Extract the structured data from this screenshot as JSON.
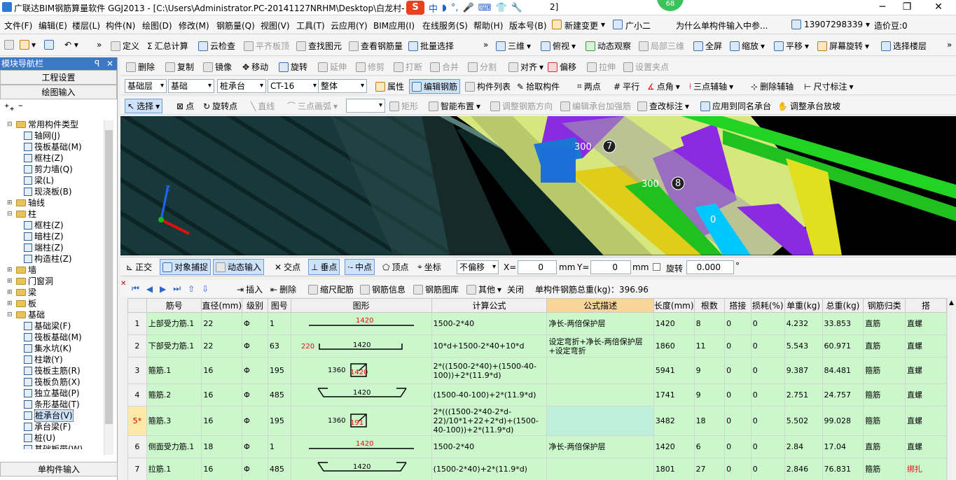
{
  "window": {
    "title": "广联达BIM钢筋算量软件 GGJ2013 - [C:\\Users\\Administrator.PC-20141127NRHM\\Desktop\\白龙村-",
    "title_suffix": "2]",
    "badge": "68",
    "ime": [
      "中",
      "◗",
      "°,",
      "🎤",
      "⌨",
      "👕",
      "🔧"
    ]
  },
  "menu": [
    "文件(F)",
    "编辑(E)",
    "楼层(L)",
    "构件(N)",
    "绘图(D)",
    "修改(M)",
    "钢筋量(Q)",
    "视图(V)",
    "工具(T)",
    "云应用(Y)",
    "BIM应用(I)",
    "在线服务(S)",
    "帮助(H)",
    "版本号(B)",
    "新建变更",
    "广小二",
    "为什么单构件输入中参...",
    "13907298339",
    "造价豆:0"
  ],
  "toolbar1": [
    "定义",
    "汇总计算",
    "云检查",
    "平齐板顶",
    "查找图元",
    "查看钢筋量",
    "批量选择",
    "三维",
    "俯视",
    "动态观察",
    "局部三维",
    "全屏",
    "缩放",
    "平移",
    "屏幕旋转",
    "选择楼层"
  ],
  "left_panel": {
    "title": "模块导航栏",
    "btn_project": "工程设置",
    "btn_draw": "绘图输入",
    "btn_single": "单构件输入",
    "tree": [
      {
        "label": "常用构件类型",
        "level": 1,
        "type": "folder",
        "open": true
      },
      {
        "label": "轴网(J)",
        "level": 2,
        "type": "item"
      },
      {
        "label": "筏板基础(M)",
        "level": 2,
        "type": "item"
      },
      {
        "label": "框柱(Z)",
        "level": 2,
        "type": "item"
      },
      {
        "label": "剪力墙(Q)",
        "level": 2,
        "type": "item"
      },
      {
        "label": "梁(L)",
        "level": 2,
        "type": "item"
      },
      {
        "label": "现浇板(B)",
        "level": 2,
        "type": "item"
      },
      {
        "label": "轴线",
        "level": 1,
        "type": "folder",
        "open": false
      },
      {
        "label": "柱",
        "level": 1,
        "type": "folder",
        "open": true
      },
      {
        "label": "框柱(Z)",
        "level": 2,
        "type": "item"
      },
      {
        "label": "暗柱(Z)",
        "level": 2,
        "type": "item"
      },
      {
        "label": "端柱(Z)",
        "level": 2,
        "type": "item"
      },
      {
        "label": "构造柱(Z)",
        "level": 2,
        "type": "item"
      },
      {
        "label": "墙",
        "level": 1,
        "type": "folder",
        "open": false
      },
      {
        "label": "门窗洞",
        "level": 1,
        "type": "folder",
        "open": false
      },
      {
        "label": "梁",
        "level": 1,
        "type": "folder",
        "open": false
      },
      {
        "label": "板",
        "level": 1,
        "type": "folder",
        "open": false
      },
      {
        "label": "基础",
        "level": 1,
        "type": "folder",
        "open": true
      },
      {
        "label": "基础梁(F)",
        "level": 2,
        "type": "item"
      },
      {
        "label": "筏板基础(M)",
        "level": 2,
        "type": "item"
      },
      {
        "label": "集水坑(K)",
        "level": 2,
        "type": "item"
      },
      {
        "label": "柱墩(Y)",
        "level": 2,
        "type": "item"
      },
      {
        "label": "筏板主筋(R)",
        "level": 2,
        "type": "item"
      },
      {
        "label": "筏板负筋(X)",
        "level": 2,
        "type": "item"
      },
      {
        "label": "独立基础(P)",
        "level": 2,
        "type": "item"
      },
      {
        "label": "条形基础(T)",
        "level": 2,
        "type": "item"
      },
      {
        "label": "桩承台(V)",
        "level": 2,
        "type": "item",
        "selected": true
      },
      {
        "label": "承台梁(F)",
        "level": 2,
        "type": "item"
      },
      {
        "label": "桩(U)",
        "level": 2,
        "type": "item"
      },
      {
        "label": "基础板带(W)",
        "level": 2,
        "type": "item"
      }
    ]
  },
  "toolbar2": [
    "删除",
    "复制",
    "镜像",
    "移动",
    "旋转",
    "延伸",
    "修剪",
    "打断",
    "合并",
    "分割",
    "对齐",
    "偏移",
    "拉伸",
    "设置夹点"
  ],
  "toolbar3": {
    "selects": [
      "基础层",
      "基础",
      "桩承台",
      "CT-16",
      "整体"
    ],
    "buttons": [
      "属性",
      "编辑钢筋",
      "构件列表",
      "拾取构件",
      "两点",
      "平行",
      "点角",
      "三点辅轴",
      "删除辅轴",
      "尺寸标注"
    ]
  },
  "toolbar4": [
    "选择",
    "点",
    "旋转点",
    "直线",
    "三点画弧",
    "矩形",
    "智能布置",
    "调整钢筋方向",
    "编辑承台加强筋",
    "查改标注",
    "应用到同名承台",
    "调整承台放坡"
  ],
  "viewport": {
    "labels": [
      "300",
      "7",
      "300",
      "8",
      "0"
    ]
  },
  "snapbar": {
    "items": [
      "正交",
      "对象捕捉",
      "动态输入",
      "交点",
      "垂点",
      "中点",
      "顶点",
      "坐标"
    ],
    "offset": "不偏移",
    "x_label": "X=",
    "x_value": "0",
    "y_label": "Y=",
    "y_value": "0",
    "unit": "mm",
    "rotate": "旋转",
    "rotate_value": "0.000",
    "deg": "°"
  },
  "gridbar": {
    "items": [
      "插入",
      "删除",
      "缩尺配筋",
      "钢筋信息",
      "钢筋图库",
      "其他",
      "关闭"
    ],
    "total": "单构件钢筋总重(kg)：396.96"
  },
  "grid": {
    "columns": [
      "",
      "筋号",
      "直径(mm)",
      "级别",
      "图号",
      "图形",
      "计算公式",
      "公式描述",
      "长度(mm)",
      "根数",
      "搭接",
      "损耗(%)",
      "单重(kg)",
      "总重(kg)",
      "钢筋归类",
      "搭"
    ],
    "rows": [
      {
        "n": "1",
        "name": "上部受力筋.1",
        "d": "22",
        "grade": "Φ",
        "fig": "1",
        "shape": "line",
        "s1": "1420",
        "s2": "",
        "s3": "",
        "formula": "1500-2*40",
        "desc": "净长-两倍保护层",
        "len": "1420",
        "cnt": "8",
        "lap": "0",
        "loss": "0",
        "unit": "4.232",
        "total": "33.853",
        "cls": "直筋",
        "conn": "直螺"
      },
      {
        "n": "2",
        "name": "下部受力筋.1",
        "d": "22",
        "grade": "Φ",
        "fig": "63",
        "shape": "bracket",
        "s1": "1420",
        "s2": "220",
        "s3": "",
        "formula": "10*d+1500-2*40+10*d",
        "desc": "设定弯折+净长-两倍保护层+设定弯折",
        "len": "1860",
        "cnt": "11",
        "lap": "0",
        "loss": "0",
        "unit": "5.543",
        "total": "60.971",
        "cls": "直筋",
        "conn": "直螺"
      },
      {
        "n": "3",
        "name": "箍筋.1",
        "d": "16",
        "grade": "Φ",
        "fig": "195",
        "shape": "stirrup",
        "s1": "1420",
        "s2": "1360",
        "s3": "",
        "formula": "2*((1500-2*40)+(1500-40-100))+2*(11.9*d)",
        "desc": "",
        "len": "5941",
        "cnt": "9",
        "lap": "0",
        "loss": "0",
        "unit": "9.387",
        "total": "84.481",
        "cls": "箍筋",
        "conn": "直螺"
      },
      {
        "n": "4",
        "name": "箍筋.2",
        "d": "16",
        "grade": "Φ",
        "fig": "485",
        "shape": "tie",
        "s1": "1420",
        "s2": "",
        "s3": "",
        "formula": "(1500-40-100)+2*(11.9*d)",
        "desc": "",
        "len": "1741",
        "cnt": "9",
        "lap": "0",
        "loss": "0",
        "unit": "2.751",
        "total": "24.757",
        "cls": "箍筋",
        "conn": "直螺"
      },
      {
        "n": "5*",
        "name": "箍筋.3",
        "d": "16",
        "grade": "Φ",
        "fig": "195",
        "shape": "stirrup",
        "s1": "191",
        "s2": "1360",
        "s3": "",
        "formula": "2*(((1500-2*40-2*d-22)/10*1+22+2*d)+(1500-40-100))+2*(11.9*d)",
        "desc": "",
        "len": "3482",
        "cnt": "18",
        "lap": "0",
        "loss": "0",
        "unit": "5.502",
        "total": "99.028",
        "cls": "箍筋",
        "conn": "直螺",
        "current": true
      },
      {
        "n": "6",
        "name": "侧面受力筋.1",
        "d": "18",
        "grade": "Φ",
        "fig": "1",
        "shape": "line",
        "s1": "1420",
        "s2": "",
        "s3": "",
        "formula": "1500-2*40",
        "desc": "净长-两倍保护层",
        "len": "1420",
        "cnt": "6",
        "lap": "0",
        "loss": "0",
        "unit": "2.84",
        "total": "17.04",
        "cls": "直筋",
        "conn": "直螺"
      },
      {
        "n": "7",
        "name": "拉筋.1",
        "d": "16",
        "grade": "Φ",
        "fig": "485",
        "shape": "tie",
        "s1": "1420",
        "s2": "",
        "s3": "",
        "formula": "(1500-2*40)+2*(11.9*d)",
        "desc": "",
        "len": "1801",
        "cnt": "27",
        "lap": "0",
        "loss": "0",
        "unit": "2.846",
        "total": "76.831",
        "cls": "箍筋",
        "conn": "绑扎"
      },
      {
        "n": "8",
        "name": "",
        "d": "",
        "grade": "",
        "fig": "",
        "shape": "",
        "s1": "",
        "s2": "",
        "s3": "",
        "formula": "",
        "desc": "",
        "len": "",
        "cnt": "",
        "lap": "",
        "loss": "",
        "unit": "",
        "total": "",
        "cls": "",
        "conn": ""
      }
    ]
  }
}
